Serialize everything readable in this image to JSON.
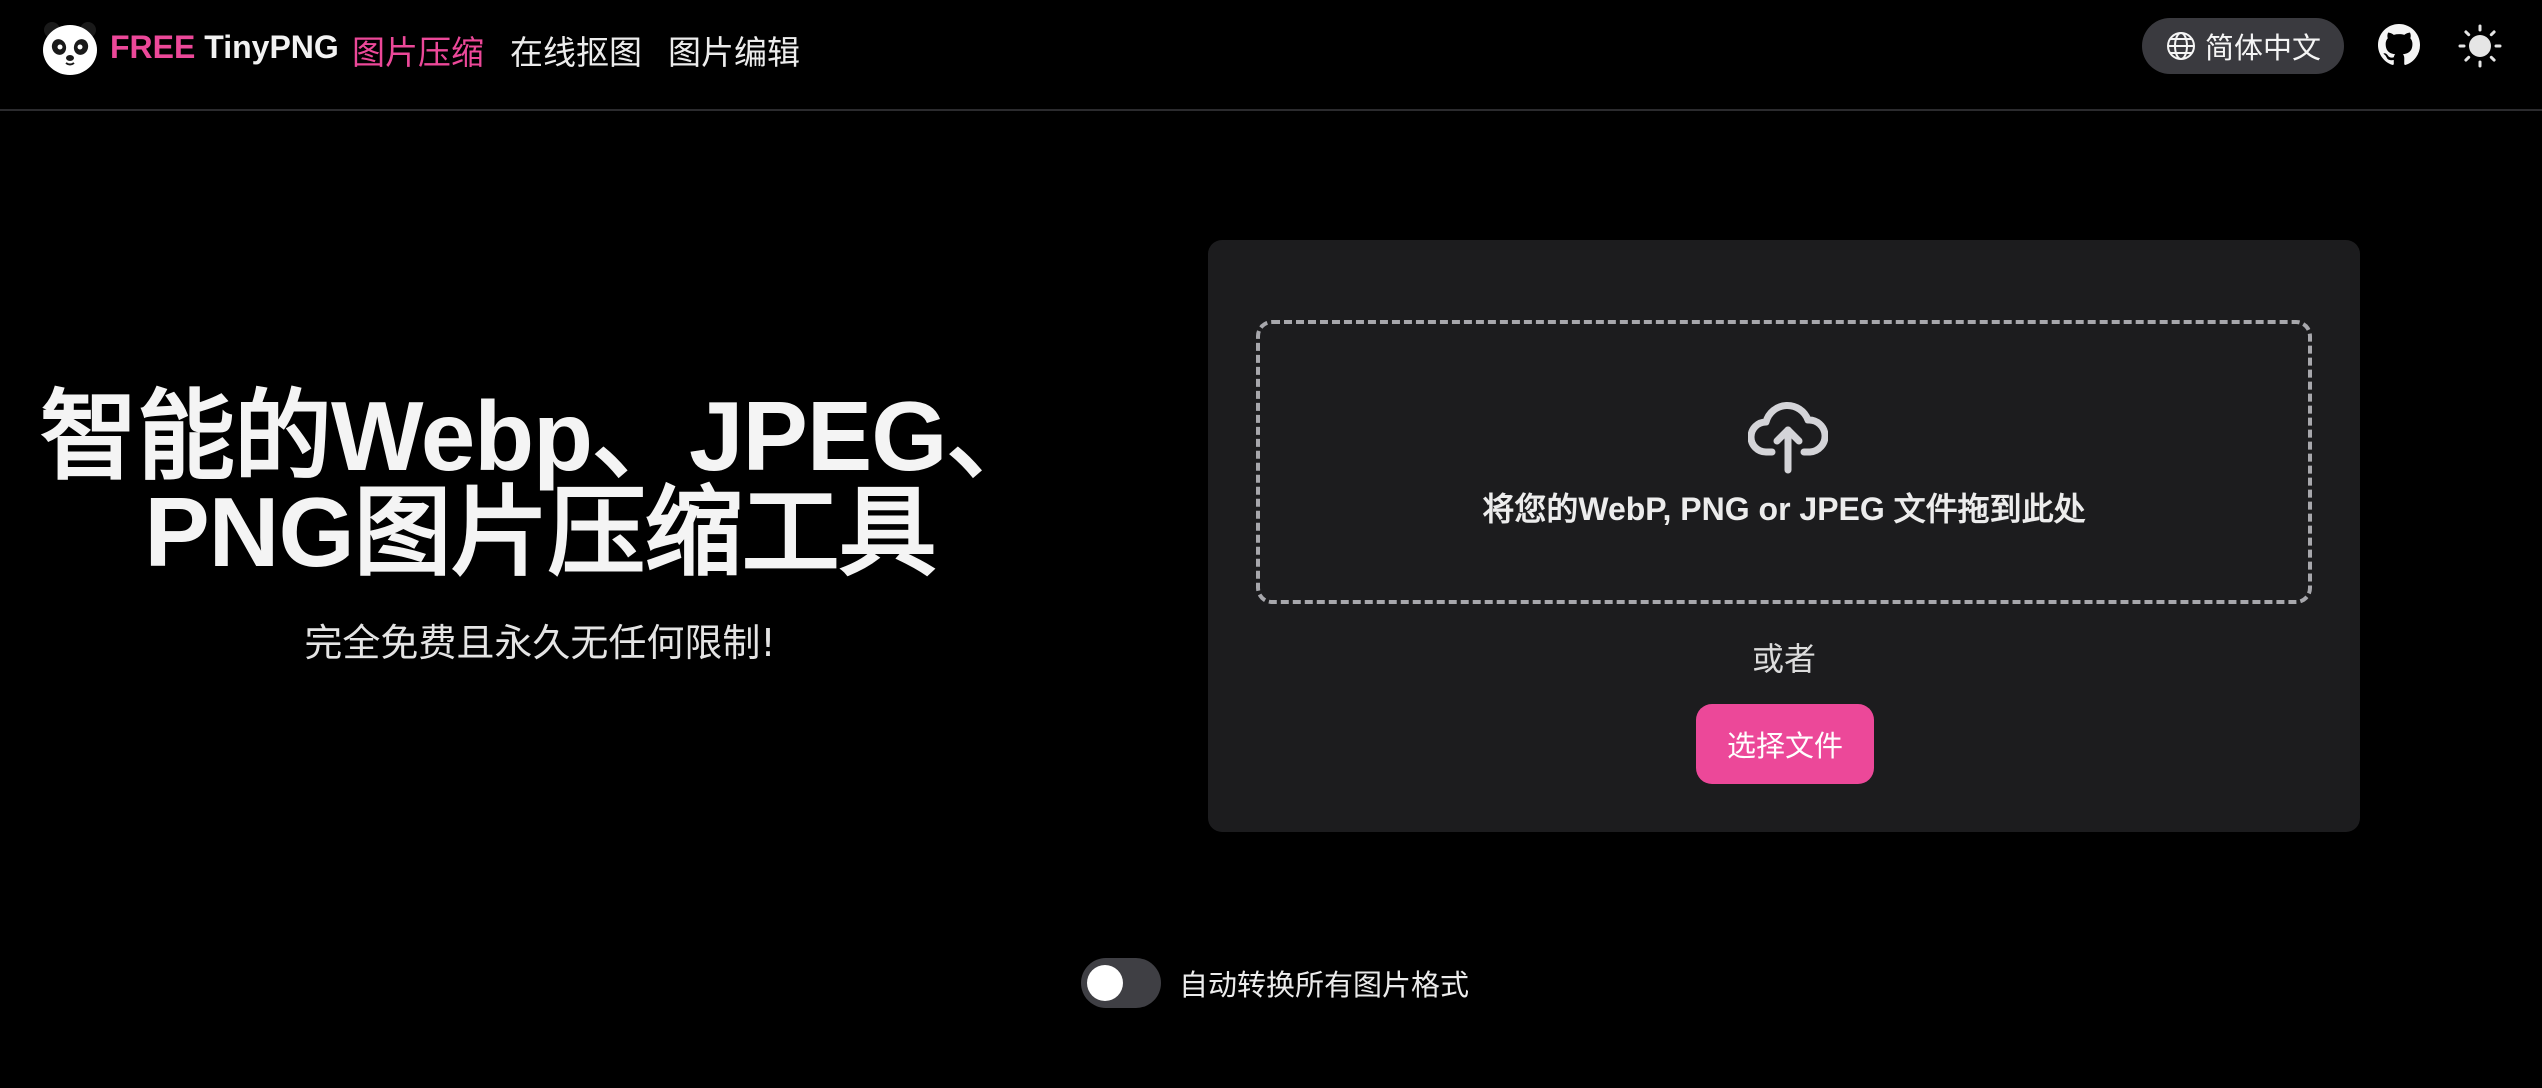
{
  "header": {
    "brand_free": "FREE",
    "brand_name": "TinyPNG",
    "nav": [
      {
        "label": "图片压缩",
        "active": true
      },
      {
        "label": "在线抠图",
        "active": false
      },
      {
        "label": "图片编辑",
        "active": false
      }
    ],
    "language_label": "简体中文",
    "icons": [
      "panda-logo-icon",
      "globe-icon",
      "github-icon",
      "sun-theme-icon"
    ]
  },
  "hero": {
    "title_line1": "智能的Webp、JPEG、",
    "title_line2": "PNG图片压缩工具",
    "subtitle": "完全免费且永久无任何限制!"
  },
  "upload": {
    "drop_text": "将您的WebP, PNG or JPEG 文件拖到此处",
    "or_text": "或者",
    "choose_button": "选择文件",
    "icon": "cloud-upload-icon"
  },
  "options": {
    "auto_convert_label": "自动转换所有图片格式",
    "auto_convert_enabled": false
  },
  "colors": {
    "accent": "#ec4899",
    "background": "#000000",
    "card": "#1c1c1e",
    "pill": "#3a3a3f"
  }
}
